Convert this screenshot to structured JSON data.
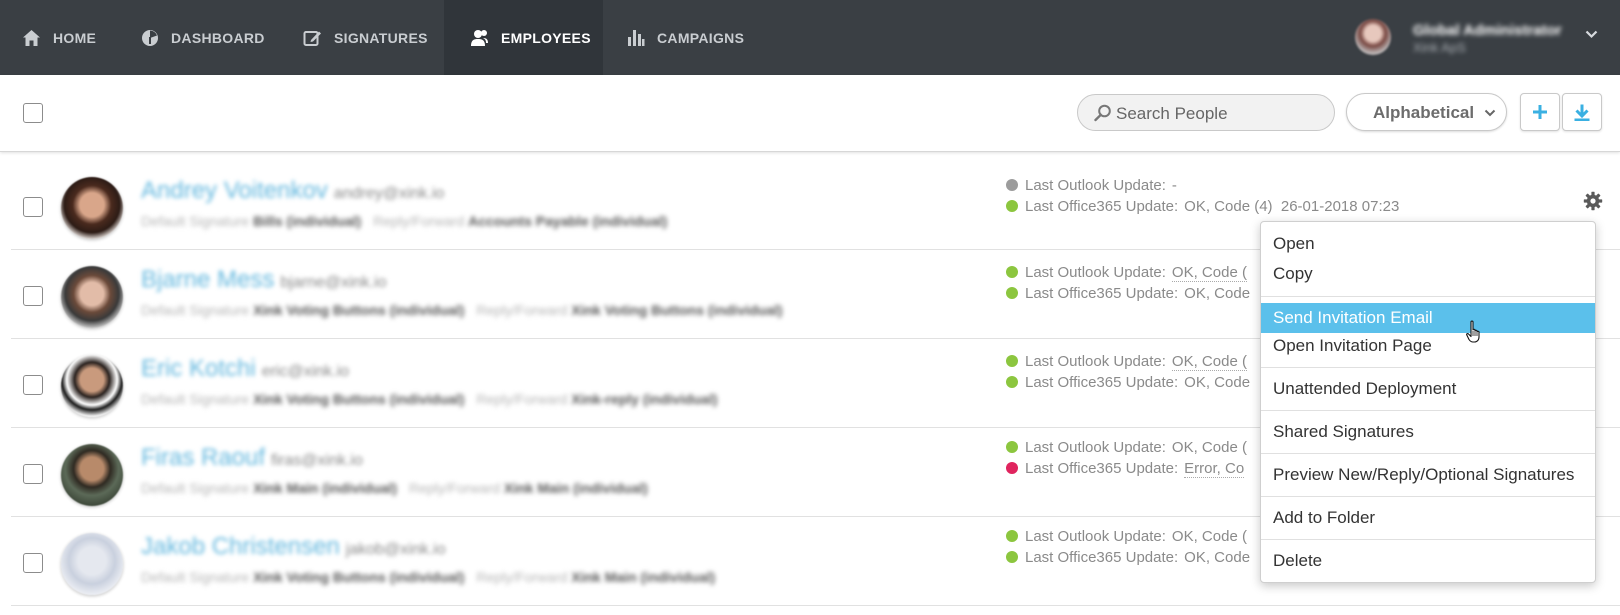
{
  "nav": {
    "home": "HOME",
    "dashboard": "DASHBOARD",
    "signatures": "SIGNATURES",
    "employees": "EMPLOYEES",
    "campaigns": "CAMPAIGNS"
  },
  "user": {
    "name": "Global Administrator",
    "org": "Xink ApS"
  },
  "toolbar": {
    "search_placeholder": "Search People",
    "sort_value": "Alphabetical",
    "add_icon": "plus-icon",
    "download_icon": "download-icon"
  },
  "employees": [
    {
      "name": "Andrey Voitenkov",
      "email": "andrey@xink.io",
      "default_label": "Default Signature",
      "default_sig": "Bills (individual)",
      "reply_label": "Reply/Forward",
      "reply_sig": "Accounts Payable (individual)",
      "outlook_label": "Last Outlook Update:",
      "outlook_value": "-",
      "office_label": "Last Office365 Update:",
      "office_value": "OK, Code (4)  26-01-2018 07:23"
    },
    {
      "name": "Bjarne Mess",
      "email": "bjarne@xink.io",
      "default_label": "Default Signature",
      "default_sig": "Xink Voting Buttons (individual)",
      "reply_label": "Reply/Forward",
      "reply_sig": "Xink Voting Buttons (individual)",
      "outlook_label": "Last Outlook Update:",
      "outlook_value": "OK, Code (",
      "office_label": "Last Office365 Update:",
      "office_value": "OK, Code"
    },
    {
      "name": "Eric Kotchi",
      "email": "eric@xink.io",
      "default_label": "Default Signature",
      "default_sig": "Xink Voting Buttons (individual)",
      "reply_label": "Reply/Forward",
      "reply_sig": "Xink-reply (individual)",
      "outlook_label": "Last Outlook Update:",
      "outlook_value": "OK, Code (",
      "office_label": "Last Office365 Update:",
      "office_value": "OK, Code"
    },
    {
      "name": "Firas Raouf",
      "email": "firas@xink.io",
      "default_label": "Default Signature",
      "default_sig": "Xink Main (individual)",
      "reply_label": "Reply/Forward",
      "reply_sig": "Xink Main (individual)",
      "outlook_label": "Last Outlook Update:",
      "outlook_value": "OK, Code (",
      "office_label": "Last Office365 Update:",
      "office_value": "Error, Co"
    },
    {
      "name": "Jakob Christensen",
      "email": "jakob@xink.io",
      "default_label": "Default Signature",
      "default_sig": "Xink Voting Buttons (individual)",
      "reply_label": "Reply/Forward",
      "reply_sig": "Xink Main (individual)",
      "outlook_label": "Last Outlook Update:",
      "outlook_value": "OK, Code (",
      "office_label": "Last Office365 Update:",
      "office_value": "OK, Code"
    }
  ],
  "status_colors": {
    "none": "#9c9c9c",
    "ok": "#8cc63f",
    "error": "#e0245e"
  },
  "context_menu": {
    "open": "Open",
    "copy": "Copy",
    "send_invitation": "Send Invitation Email",
    "open_invitation": "Open Invitation Page",
    "unattended": "Unattended Deployment",
    "shared": "Shared Signatures",
    "preview": "Preview New/Reply/Optional Signatures",
    "add_folder": "Add to Folder",
    "delete": "Delete"
  },
  "colors": {
    "nav_bg": "#3a3f44",
    "accent": "#5bc0eb",
    "name_link": "#62b7de"
  }
}
